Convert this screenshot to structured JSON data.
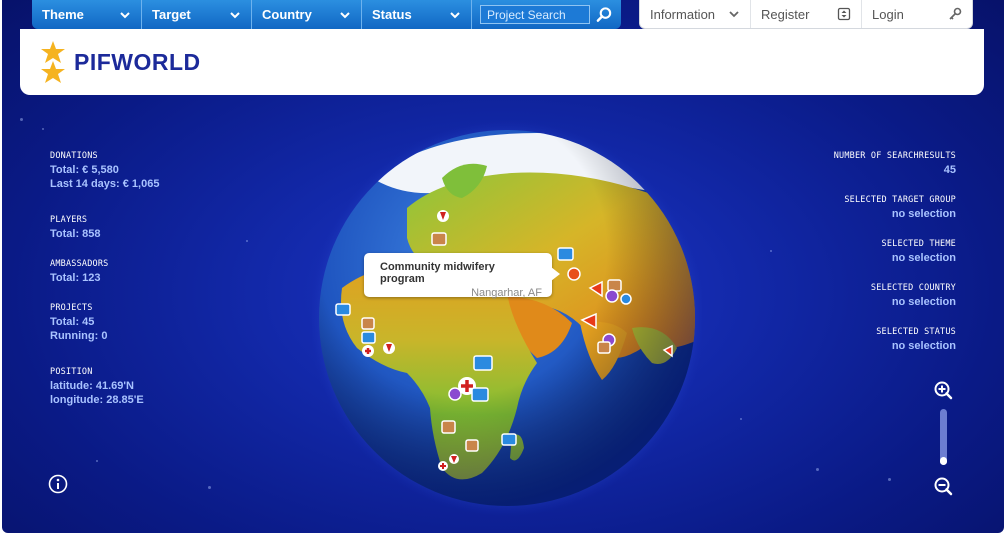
{
  "nav": {
    "items": [
      {
        "label": "Theme"
      },
      {
        "label": "Target"
      },
      {
        "label": "Country"
      },
      {
        "label": "Status"
      }
    ],
    "search_placeholder": "Project Search"
  },
  "user_nav": {
    "information": "Information",
    "register": "Register",
    "login": "Login"
  },
  "brand": {
    "name": "PIFWORLD"
  },
  "stats": {
    "donations": {
      "label": "DONATIONS",
      "total": "Total: € 5,580",
      "last14": "Last 14 days: € 1,065"
    },
    "players": {
      "label": "PLAYERS",
      "total": "Total: 858"
    },
    "ambassadors": {
      "label": "AMBASSADORS",
      "total": "Total: 123"
    },
    "projects": {
      "label": "PROJECTS",
      "total": "Total: 45",
      "running": "Running: 0"
    },
    "position": {
      "label": "POSITION",
      "latitude": "latitude: 41.69'N",
      "longitude": "longitude: 28.85'E"
    }
  },
  "results": {
    "count": {
      "label": "NUMBER OF SEARCHRESULTS",
      "value": "45"
    },
    "target_group": {
      "label": "SELECTED TARGET GROUP",
      "value": "no selection"
    },
    "theme": {
      "label": "SELECTED THEME",
      "value": "no selection"
    },
    "country": {
      "label": "SELECTED COUNTRY",
      "value": "no selection"
    },
    "status": {
      "label": "SELECTED STATUS",
      "value": "no selection"
    }
  },
  "tooltip": {
    "title": "Community midwifery program",
    "location": "Nangarhar, AF"
  },
  "zoom": {
    "level": 0.15
  },
  "colors": {
    "nav_blue": "#1a7ad6",
    "brand_navy": "#1c2a9a",
    "stat_value": "#a9c3ff",
    "logo_star": "#f5b320"
  }
}
